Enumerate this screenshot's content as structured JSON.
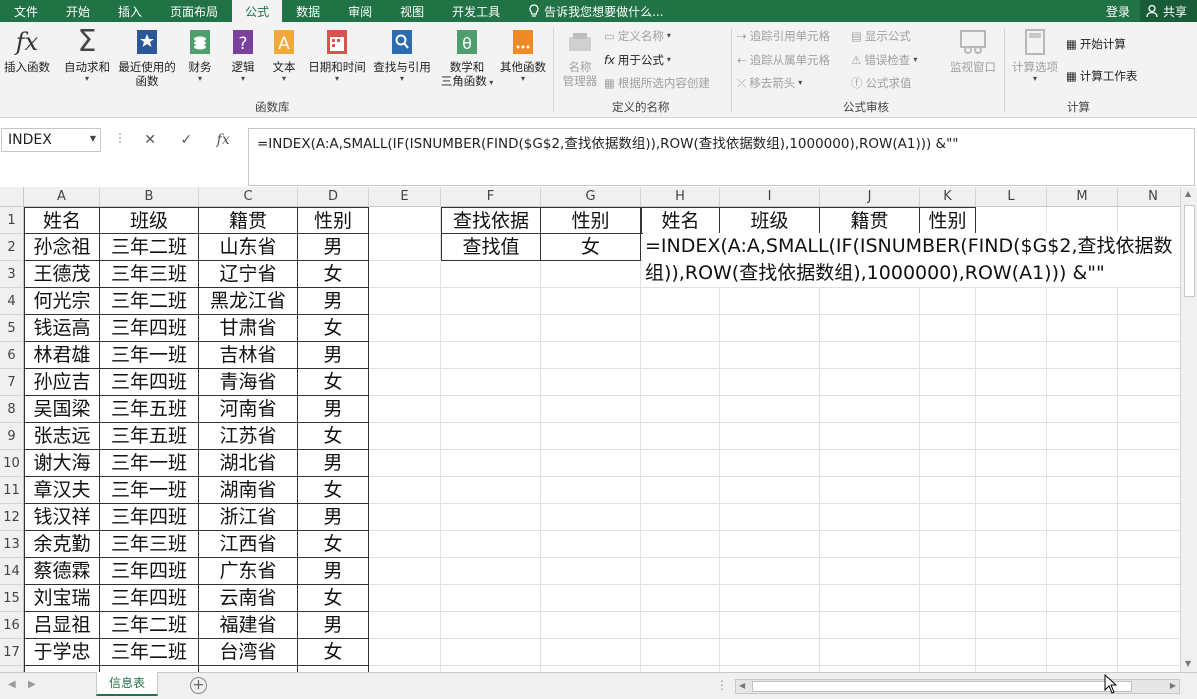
{
  "tabs": [
    "文件",
    "开始",
    "插入",
    "页面布局",
    "公式",
    "数据",
    "审阅",
    "视图",
    "开发工具"
  ],
  "active_tab": "公式",
  "tell_me": "告诉我您想要做什么...",
  "login": "登录",
  "share": "共享",
  "ribbon": {
    "function_library": {
      "label": "函数库",
      "insert_function": "插入函数",
      "autosum": "自动求和",
      "recent_1": "最近使用的",
      "recent_2": "函数",
      "financial": "财务",
      "logical": "逻辑",
      "text": "文本",
      "datetime": "日期和时间",
      "lookup": "查找与引用",
      "math_1": "数学和",
      "math_2": "三角函数",
      "more": "其他函数"
    },
    "defined_names": {
      "label": "定义的名称",
      "name_manager_1": "名称",
      "name_manager_2": "管理器",
      "define_name": "定义名称",
      "use_in_formula": "用于公式",
      "create_from_selection": "根据所选内容创建"
    },
    "formula_auditing": {
      "label": "公式审核",
      "trace_precedents": "追踪引用单元格",
      "trace_dependents": "追踪从属单元格",
      "remove_arrows": "移去箭头",
      "show_formulas": "显示公式",
      "error_checking": "错误检查",
      "evaluate_formula": "公式求值",
      "watch_window": "监视窗口"
    },
    "calculation": {
      "label": "计算",
      "calc_options": "计算选项",
      "calc_now": "开始计算",
      "calc_sheet": "计算工作表"
    }
  },
  "formula_bar": {
    "name_box": "INDEX",
    "formula": "=INDEX(A:A,SMALL(IF(ISNUMBER(FIND($G$2,查找依据数组)),ROW(查找依据数组),1000000),ROW(A1))) &\"\""
  },
  "columns": [
    "A",
    "B",
    "C",
    "D",
    "E",
    "F",
    "G",
    "H",
    "I",
    "J",
    "K",
    "L",
    "M",
    "N"
  ],
  "rows": [
    "1",
    "2",
    "3",
    "4",
    "5",
    "6",
    "7",
    "8",
    "9",
    "10",
    "11",
    "12",
    "13",
    "14",
    "15",
    "16",
    "17"
  ],
  "table": {
    "headers": [
      "姓名",
      "班级",
      "籍贯",
      "性别"
    ],
    "data": [
      [
        "孙念祖",
        "三年二班",
        "山东省",
        "男"
      ],
      [
        "王德茂",
        "三年三班",
        "辽宁省",
        "女"
      ],
      [
        "何光宗",
        "三年二班",
        "黑龙江省",
        "男"
      ],
      [
        "钱运高",
        "三年四班",
        "甘肃省",
        "女"
      ],
      [
        "林君雄",
        "三年一班",
        "吉林省",
        "男"
      ],
      [
        "孙应吉",
        "三年四班",
        "青海省",
        "女"
      ],
      [
        "吴国梁",
        "三年五班",
        "河南省",
        "男"
      ],
      [
        "张志远",
        "三年五班",
        "江苏省",
        "女"
      ],
      [
        "谢大海",
        "三年一班",
        "湖北省",
        "男"
      ],
      [
        "章汉夫",
        "三年一班",
        "湖南省",
        "女"
      ],
      [
        "钱汉祥",
        "三年四班",
        "浙江省",
        "男"
      ],
      [
        "余克勤",
        "三年三班",
        "江西省",
        "女"
      ],
      [
        "蔡德霖",
        "三年四班",
        "广东省",
        "男"
      ],
      [
        "刘宝瑞",
        "三年四班",
        "云南省",
        "女"
      ],
      [
        "吕显祖",
        "三年二班",
        "福建省",
        "男"
      ],
      [
        "于学忠",
        "三年二班",
        "台湾省",
        "女"
      ]
    ]
  },
  "lookup": {
    "f1": "查找依据",
    "g1": "性别",
    "f2": "查找值",
    "g2": "女"
  },
  "result_headers": [
    "姓名",
    "班级",
    "籍贯",
    "性别"
  ],
  "cell_edit": "=INDEX(A:A,SMALL(IF(ISNUMBER(FIND($G$2,查找依据数组)),ROW(查找依据数组),1000000),ROW(A1))) &\"\"",
  "sheet_tab": "信息表",
  "colors": {
    "accent": "#217346"
  }
}
